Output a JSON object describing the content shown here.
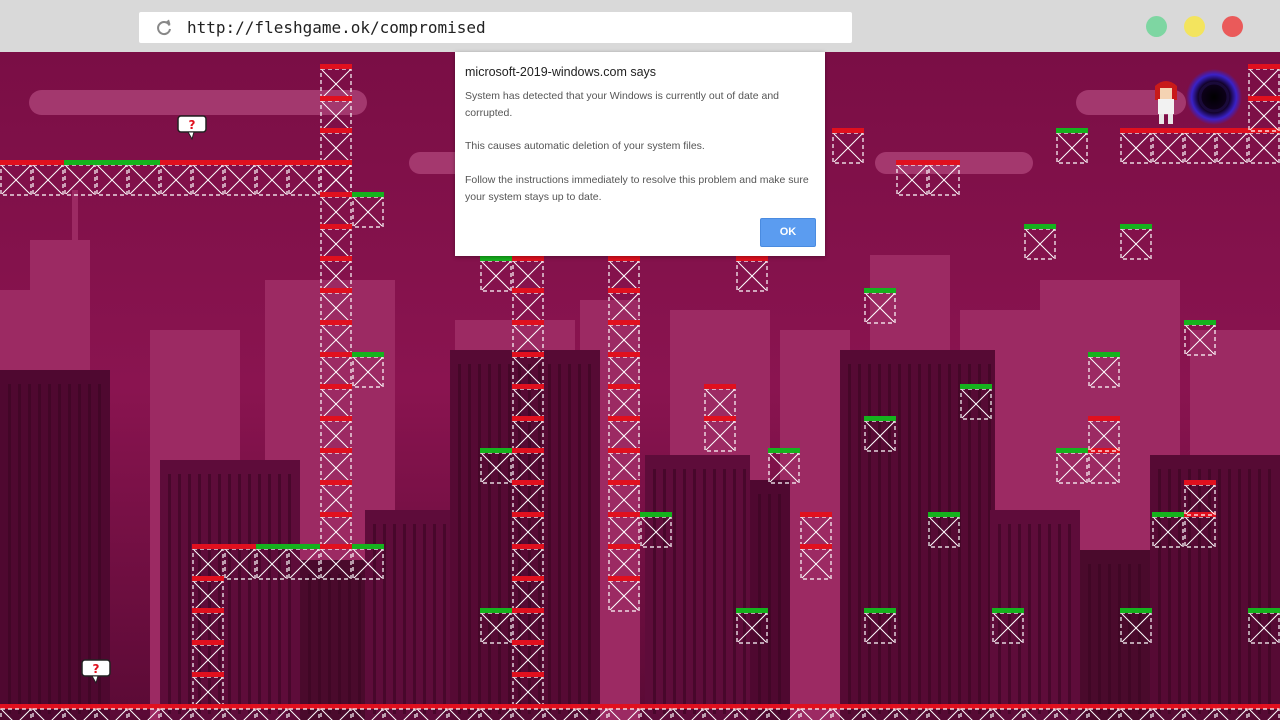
{
  "browser": {
    "url": "http://fleshgame.ok/compromised",
    "window_buttons": [
      {
        "name": "minimize",
        "color": "#7ed6a2"
      },
      {
        "name": "maximize",
        "color": "#f3e45e"
      },
      {
        "name": "close",
        "color": "#ea5a5a"
      }
    ]
  },
  "dialog": {
    "title": "microsoft-2019-windows.com says",
    "message_1": "System has detected that your Windows is currently out of date and corrupted.",
    "message_2": "This causes automatic deletion of your system files.",
    "message_3": "Follow the instructions immediately to resolve this problem and make sure your system stays up to date.",
    "ok_label": "OK"
  },
  "game": {
    "colors": {
      "sky": "#7e0f47",
      "accent_red": "#e0101e",
      "accent_green": "#15b21d",
      "crate_stroke": "#ffffff"
    },
    "hint_bubble_symbol": "?",
    "player": "red-haired-character",
    "portal": "dark-vortex-portal"
  }
}
